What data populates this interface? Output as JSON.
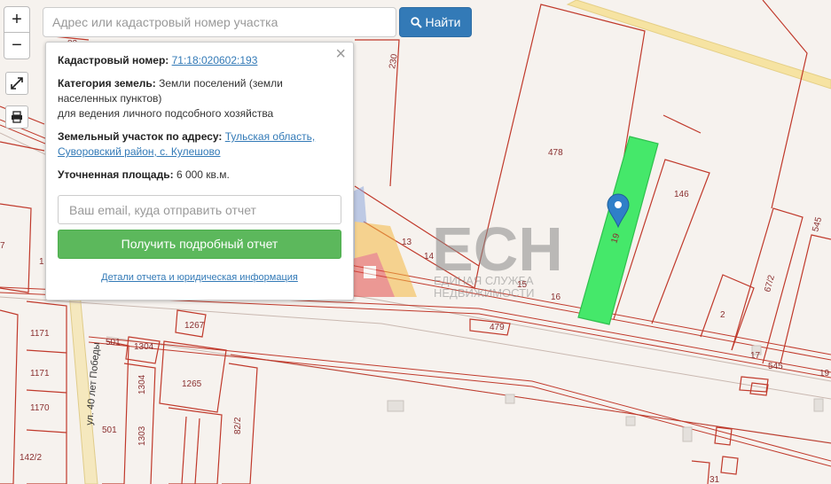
{
  "search": {
    "placeholder": "Адрес или кадастровый номер участка",
    "button_label": "Найти"
  },
  "controls": {
    "zoom_in": "+",
    "zoom_out": "−"
  },
  "popup": {
    "cadastral_label": "Кадастровый номер:",
    "cadastral_number": "71:18:020602:193",
    "category_label": "Категория земель:",
    "category_value": "Земли поселений (земли населенных пунктов)",
    "usage_value": "для ведения личного подсобного хозяйства",
    "address_label": "Земельный участок по адресу:",
    "address_value": "Тульская область, Суворовский район, с. Кулешово",
    "area_label": "Уточненная площадь:",
    "area_value": "6 000 кв.м.",
    "email_placeholder": "Ваш email, куда отправить отчет",
    "report_button": "Получить подробный отчет",
    "details_link": "Детали отчета и юридическая информация",
    "close": "×"
  },
  "watermark": {
    "brand": "ЕСН",
    "line1": "ЕДИНАЯ СЛУЖБА",
    "line2": "НЕДВИЖИМОСТИ"
  },
  "map": {
    "street_name": "ул. 40 лет Победы",
    "highlight_color": "#45e86a",
    "boundary_color": "#c0392b",
    "parcel_labels": [
      {
        "text": "82"
      },
      {
        "text": "230"
      },
      {
        "text": "478"
      },
      {
        "text": "146"
      },
      {
        "text": "545"
      },
      {
        "text": "13"
      },
      {
        "text": "14"
      },
      {
        "text": "15"
      },
      {
        "text": "16"
      },
      {
        "text": "19"
      },
      {
        "text": "67/2"
      },
      {
        "text": "2"
      },
      {
        "text": "17"
      },
      {
        "text": "545"
      },
      {
        "text": "19"
      },
      {
        "text": "479"
      },
      {
        "text": "1267"
      },
      {
        "text": "1304"
      },
      {
        "text": "501"
      },
      {
        "text": "1304"
      },
      {
        "text": "1265"
      },
      {
        "text": "82/2"
      },
      {
        "text": "1303"
      },
      {
        "text": "501"
      },
      {
        "text": "1171"
      },
      {
        "text": "1171"
      },
      {
        "text": "1170"
      },
      {
        "text": "142/2"
      },
      {
        "text": "7"
      },
      {
        "text": "1"
      },
      {
        "text": "31"
      }
    ]
  }
}
